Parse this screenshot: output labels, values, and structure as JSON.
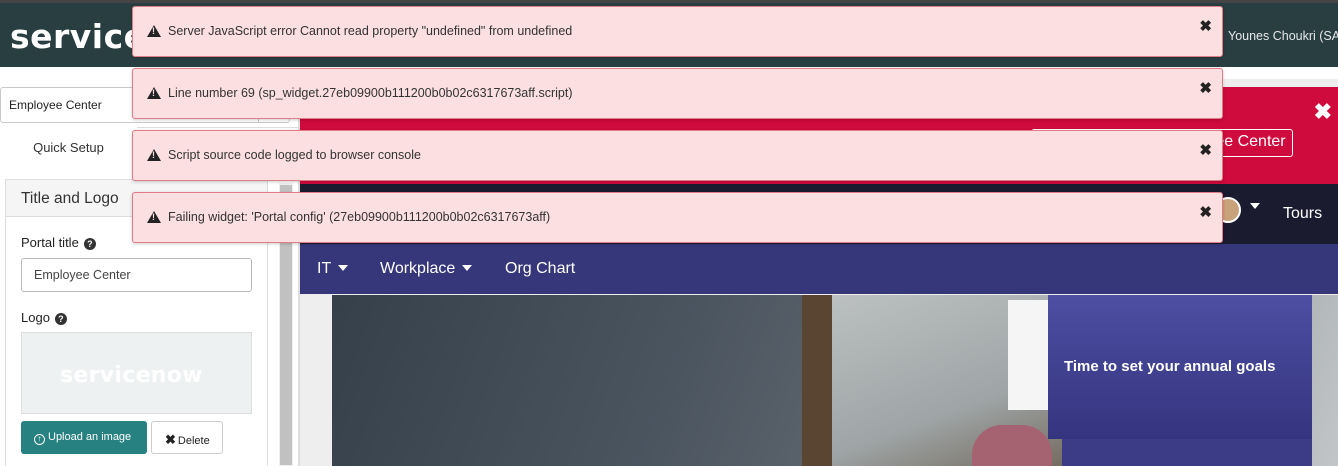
{
  "header": {
    "logo": "servicenow",
    "user_name": "Younes Choukri (SA"
  },
  "config_panel": {
    "portal_select_value": "Employee Center",
    "tab_label": "Quick Setup",
    "section_title": "Title and Logo",
    "portal_title_label": "Portal title",
    "portal_title_value": "Employee Center",
    "logo_label": "Logo",
    "logo_preview_text": "servicenow",
    "upload_label": "Upload an image",
    "delete_label": "Delete"
  },
  "preview": {
    "announcement_link": "Employee Center",
    "tours_label": "Tours",
    "menu": [
      {
        "label": "IT"
      },
      {
        "label": "Workplace"
      },
      {
        "label": "Org Chart"
      }
    ],
    "goal_card_title": "Time to set your annual goals"
  },
  "errors": [
    {
      "message": "Server JavaScript error Cannot read property \"undefined\" from undefined"
    },
    {
      "message": "Line number 69 (sp_widget.27eb09900b111200b0b02c6317673aff.script)"
    },
    {
      "message": "Script source code logged to browser console"
    },
    {
      "message": "Failing widget: 'Portal config' (27eb09900b111200b0b02c6317673aff)"
    }
  ],
  "colors": {
    "header_bg": "#293e40",
    "announcement_red": "#cf0a3d",
    "menu_purple": "#36367a",
    "upload_teal": "#278181",
    "alert_bg": "#fcdfe1"
  }
}
